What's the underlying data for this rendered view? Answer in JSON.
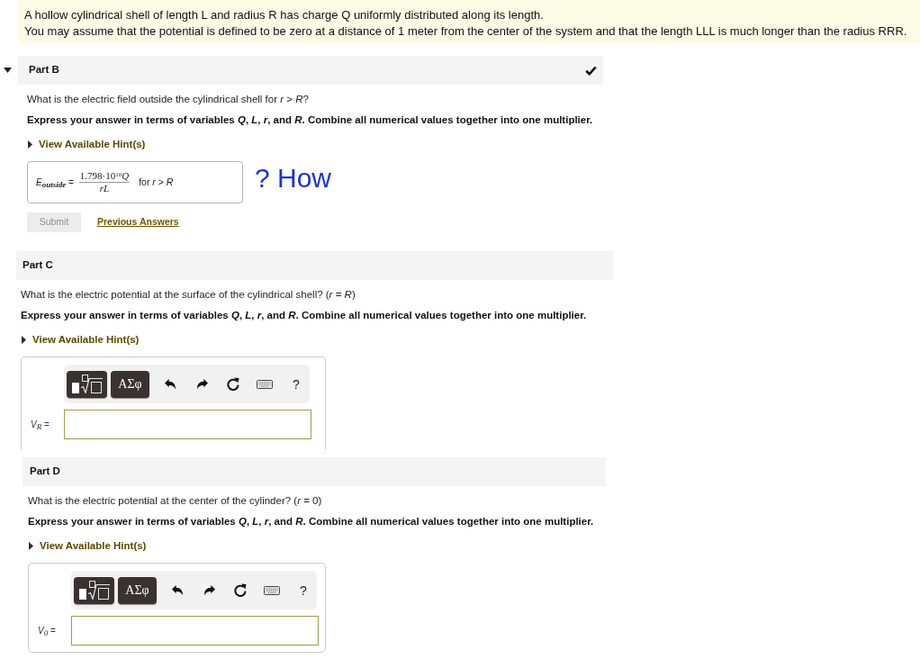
{
  "problem": {
    "lines": [
      "A hollow cylindrical shell of length L and radius R has charge Q uniformly distributed along its length.",
      "You may assume that the potential is defined to be zero at a distance of 1 meter from the center of the system and that the length LLL is much longer than the radius RRR."
    ]
  },
  "parts": [
    {
      "kind": "answered",
      "title": "Part B",
      "expanded": true,
      "correct": true,
      "question": "What is the electric field outside the cylindrical shell for *r* > *R*?",
      "instruction": "Express your answer in terms of variables *Q*, *L*, *r*, and *R*. Combine all numerical values together into one multiplier.",
      "hint_link": "View Available Hint(s)",
      "answer": {
        "label": "*E*$_{outside}$ =",
        "numerator": "1.798·10$^{10}$*Q*",
        "denominator": "*rL*",
        "condition": "for *r* > *R*"
      },
      "handwritten_note": "? How",
      "submit": {
        "label": "Submit",
        "disabled": true
      },
      "previous_answers_link": "Previous Answers"
    },
    {
      "kind": "entry",
      "title": "Part C",
      "correct": false,
      "question": "What is the electric potential at the surface of the cylindrical shell? (*r* = *R*)",
      "instruction": "Express your answer in terms of variables *Q*, *L*, *r*, and *R*. Combine all numerical values together into one multiplier.",
      "hint_link": "View Available Hint(s)",
      "toolbar": [
        {
          "kind": "templates"
        },
        {
          "kind": "symbols",
          "label": "ΑΣφ"
        },
        {
          "kind": "undo"
        },
        {
          "kind": "redo"
        },
        {
          "kind": "reset"
        },
        {
          "kind": "keyboard"
        },
        {
          "kind": "help",
          "label": "?"
        }
      ],
      "input_label": "*V*$_{R}$ ="
    },
    {
      "kind": "entry",
      "title": "Part D",
      "correct": false,
      "question": "What is the electric potential at the center of the cylinder? (*r* = 0)",
      "instruction": "Express your answer in terms of variables *Q*, *L*, *r*, and *R*. Combine all numerical values together into one multiplier.",
      "hint_link": "View Available Hint(s)",
      "toolbar": [
        {
          "kind": "templates"
        },
        {
          "kind": "symbols",
          "label": "ΑΣφ"
        },
        {
          "kind": "undo"
        },
        {
          "kind": "redo"
        },
        {
          "kind": "reset"
        },
        {
          "kind": "keyboard"
        },
        {
          "kind": "help",
          "label": "?"
        }
      ],
      "input_label": "*V*$_{0}$ ="
    }
  ]
}
